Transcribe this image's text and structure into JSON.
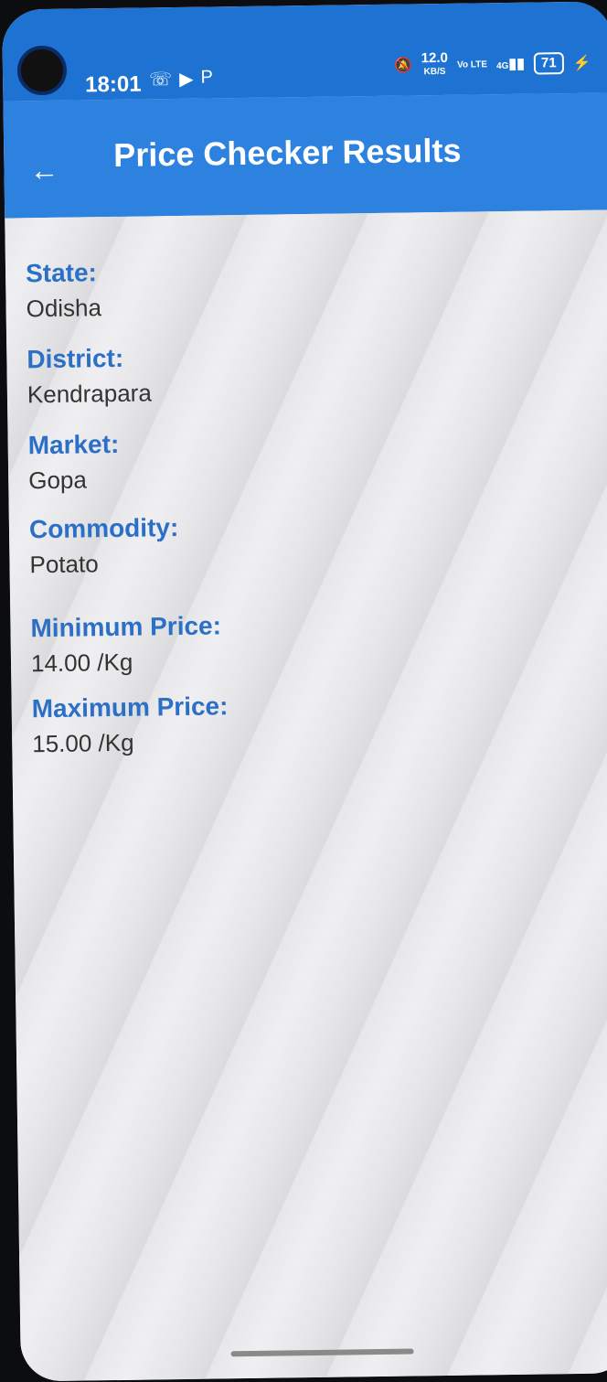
{
  "status_bar": {
    "time": "18:01",
    "left_icons": [
      "whatsapp-icon",
      "youtube-icon",
      "paytm-icon"
    ],
    "network_speed": "12.0",
    "network_speed_unit": "KB/S",
    "volte": "Vo LTE",
    "signal": "4G",
    "battery": "71"
  },
  "app_bar": {
    "title": "Price Checker Results",
    "back_icon": "arrow-back-icon"
  },
  "results": {
    "state_label": "State:",
    "state_value": "Odisha",
    "district_label": "District:",
    "district_value": "Kendrapara",
    "market_label": "Market:",
    "market_value": "Gopa",
    "commodity_label": "Commodity:",
    "commodity_value": "Potato",
    "min_price_label": "Minimum Price:",
    "min_price_value": "14.00 /Kg",
    "max_price_label": "Maximum Price:",
    "max_price_value": "15.00 /Kg"
  },
  "colors": {
    "app_bar": "#2d82e0",
    "status_bar": "#1e73d2",
    "label": "#2b6fc7",
    "value": "#333333",
    "background": "#e7e7ea"
  }
}
